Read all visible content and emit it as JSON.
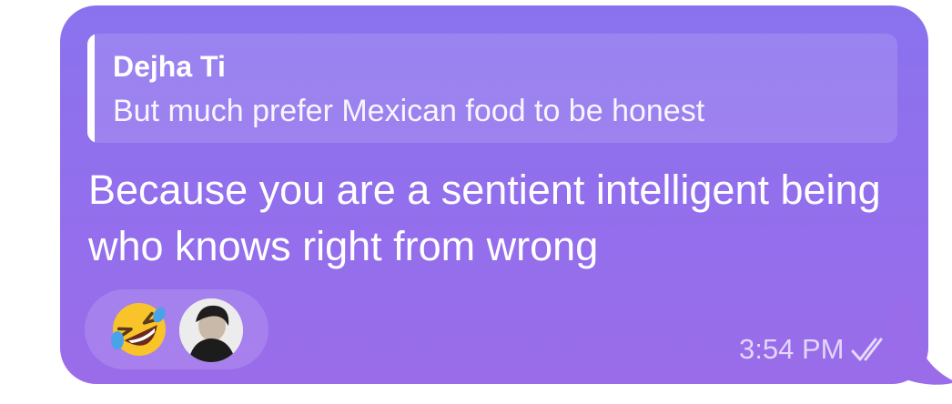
{
  "message": {
    "reply": {
      "author": "Dejha Ti",
      "text": "But much prefer Mexican food to be honest"
    },
    "text": "Because you are a sentient intelligent being who knows right from wrong",
    "time": "3:54 PM",
    "status": "read",
    "reactions": [
      {
        "icon": "rolling-on-floor-laughing-emoji"
      },
      {
        "icon": "user-avatar"
      }
    ]
  },
  "colors": {
    "bubble_top": "#8a72ee",
    "bubble_bottom": "#9a6cea",
    "text": "#ffffff"
  }
}
